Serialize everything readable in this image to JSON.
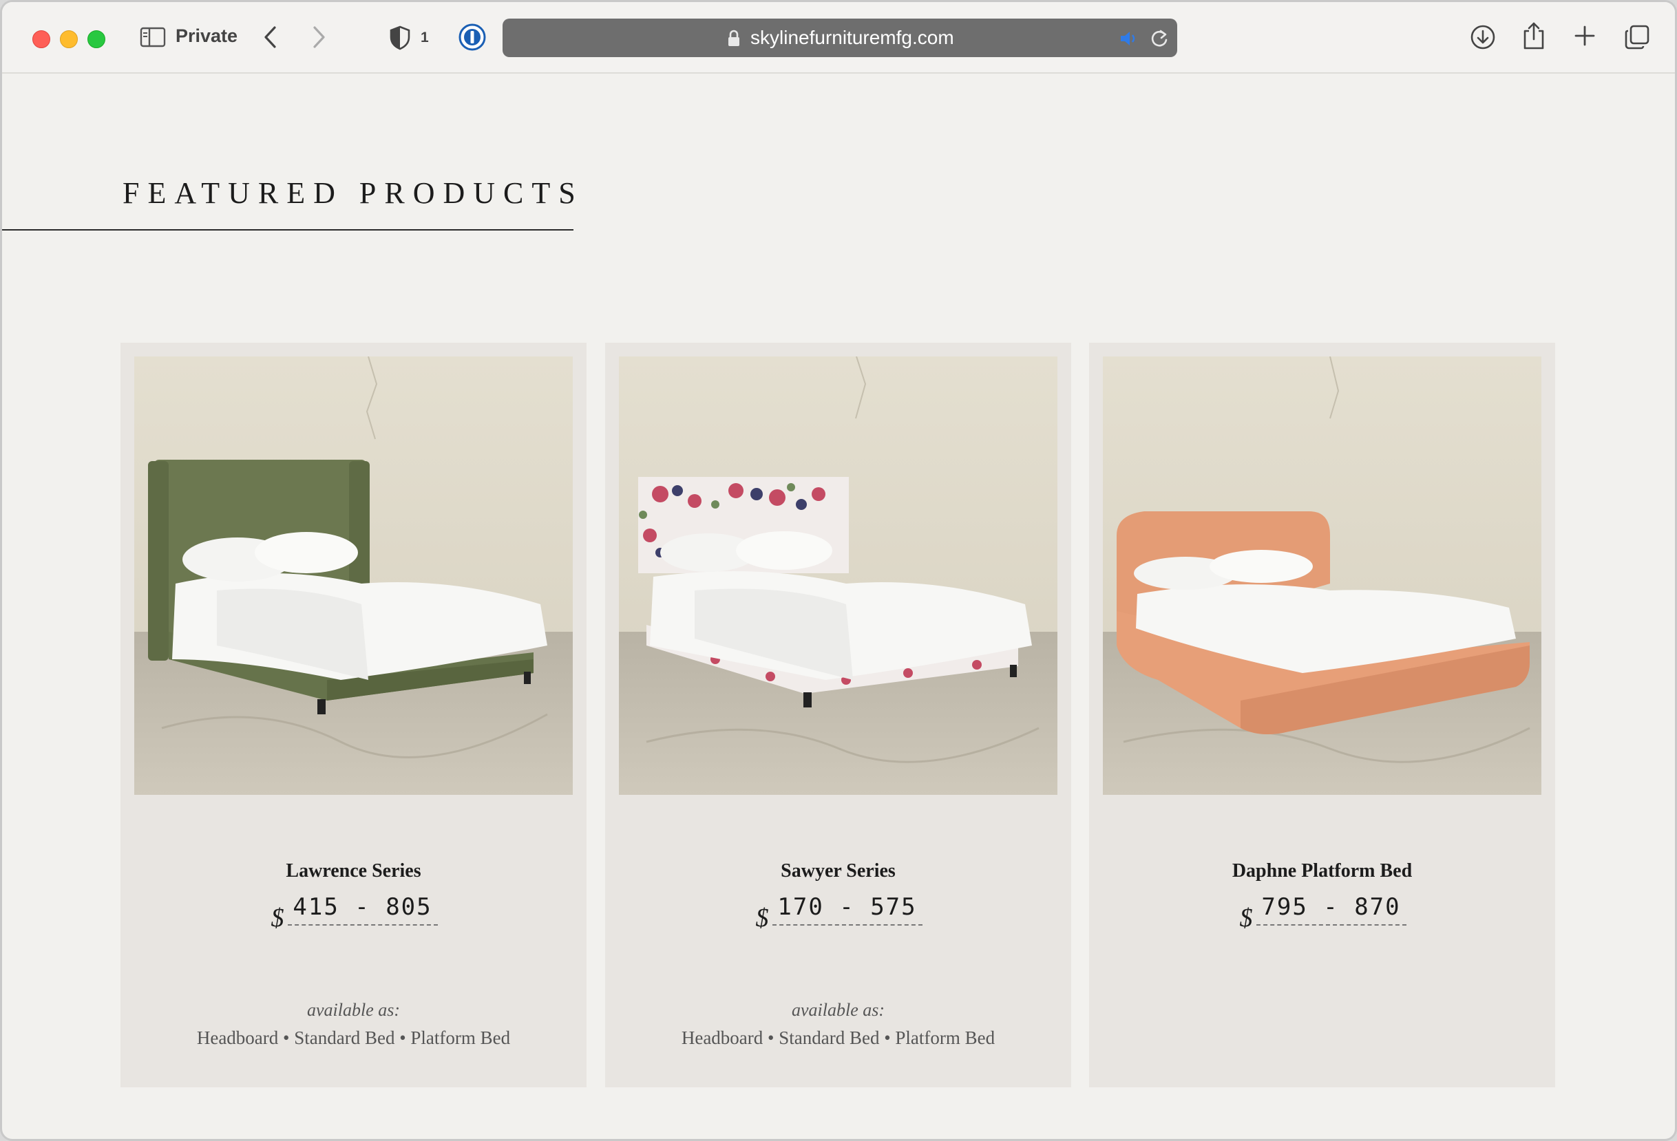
{
  "browser": {
    "private_label": "Private",
    "shield_count": "1",
    "url": "skylinefurnituremfg.com"
  },
  "page": {
    "section_title": "FEATURED PRODUCTS",
    "products": [
      {
        "name": "Lawrence Series",
        "currency": "$",
        "price_range": "415 - 805",
        "available_label": "available as:",
        "available_options": "Headboard • Standard Bed • Platform Bed"
      },
      {
        "name": "Sawyer Series",
        "currency": "$",
        "price_range": "170 - 575",
        "available_label": "available as:",
        "available_options": "Headboard • Standard Bed • Platform Bed"
      },
      {
        "name": "Daphne Platform Bed",
        "currency": "$",
        "price_range": "795 - 870"
      }
    ]
  },
  "colors": {
    "page_bg": "#f2f1ee",
    "card_bg": "#e8e5e1",
    "bed_green": "#6f7a52",
    "bed_floral": "#f1ecea",
    "bed_peach": "#e79f78"
  }
}
